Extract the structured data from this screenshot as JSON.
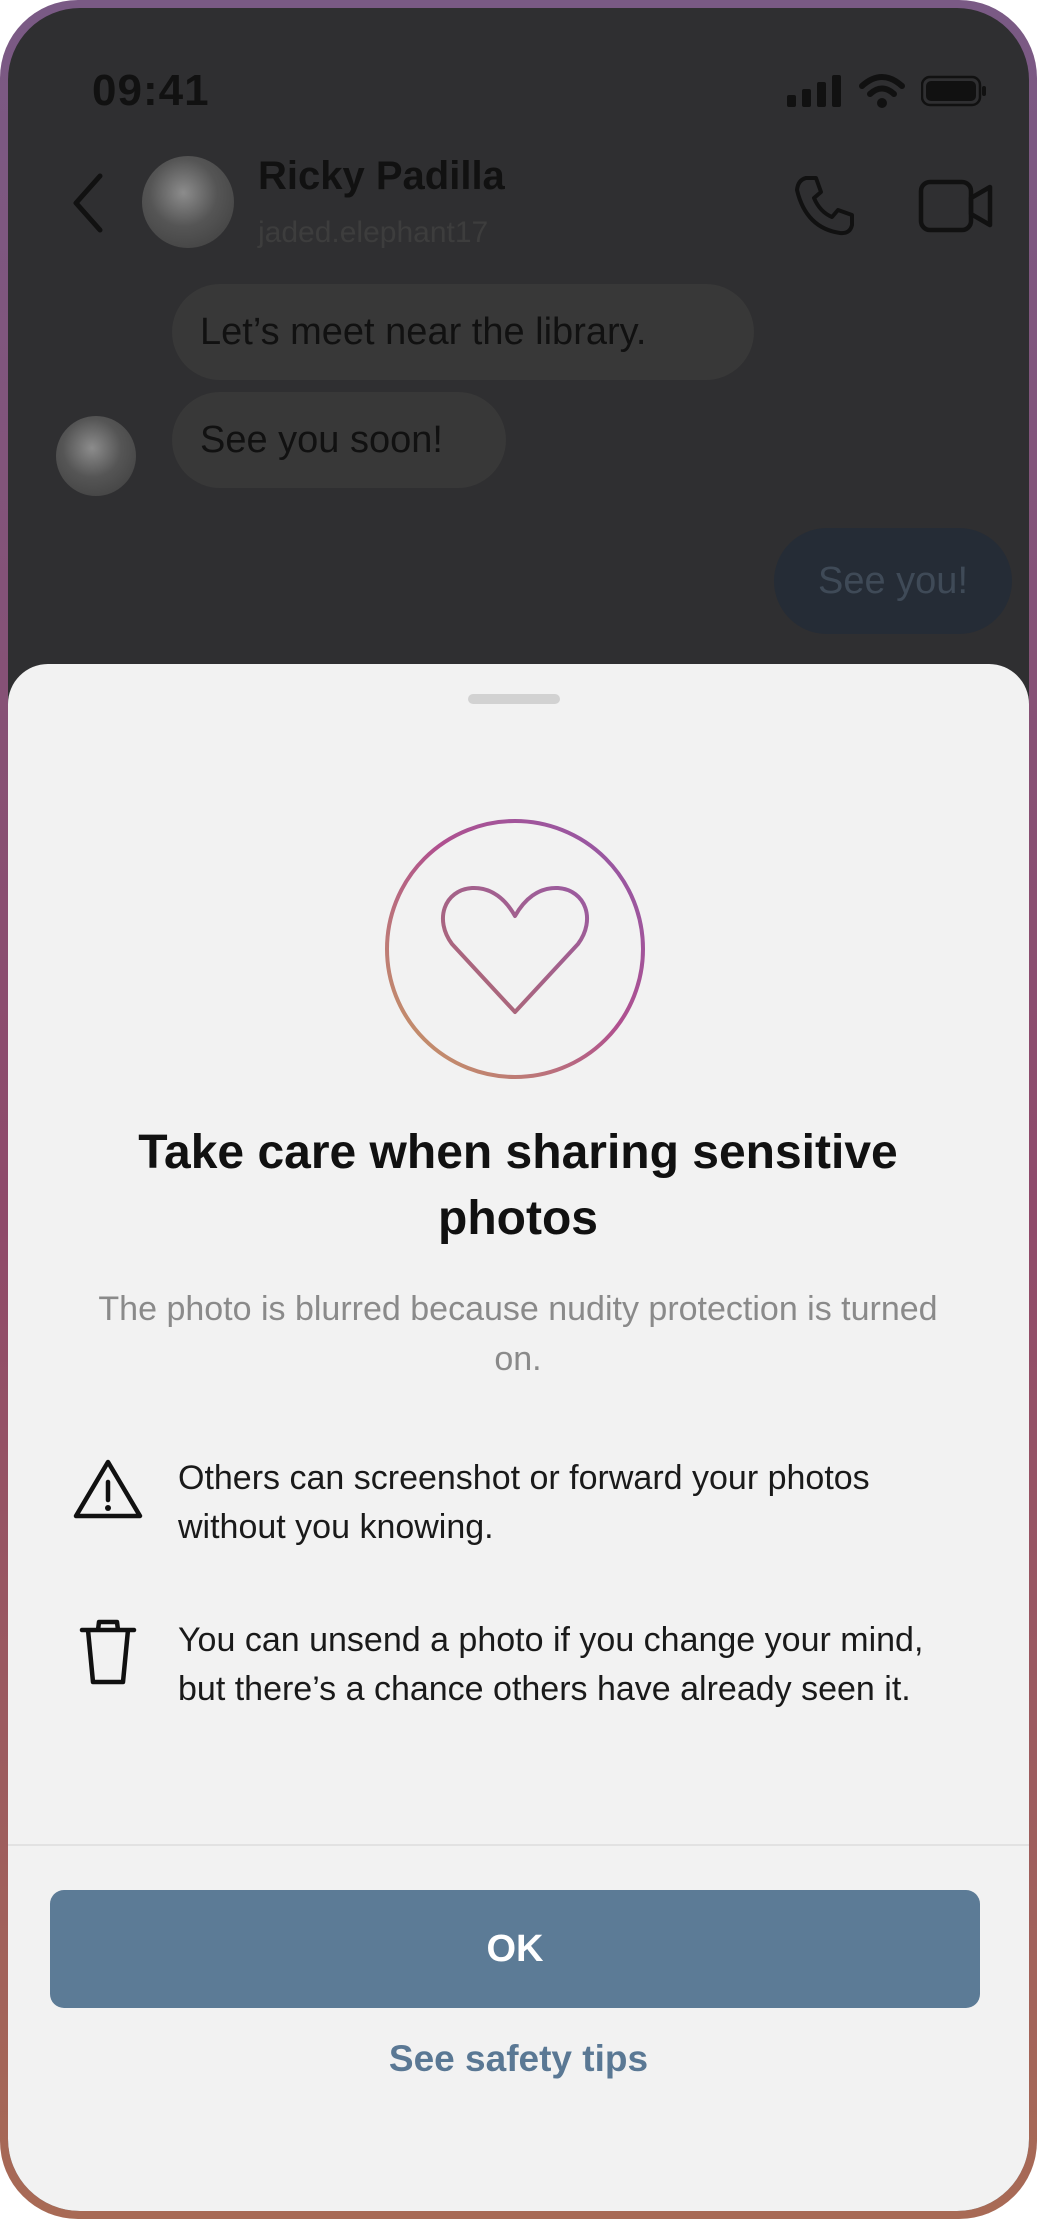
{
  "status_bar": {
    "time": "09:41",
    "icons": [
      "signal-icon",
      "wifi-icon",
      "battery-icon"
    ]
  },
  "header": {
    "contact_name": "Ricky Padilla",
    "username": "jaded.elephant17",
    "icons": [
      "back-chevron-icon",
      "phone-icon",
      "video-camera-icon"
    ]
  },
  "messages": [
    {
      "direction": "incoming",
      "text": "Let’s meet near the library."
    },
    {
      "direction": "incoming",
      "text": "See you soon!"
    },
    {
      "direction": "outgoing",
      "text": "See you!"
    }
  ],
  "sheet": {
    "title": "Take care when sharing sensitive photos",
    "subtitle": "The photo is blurred because nudity protection is turned on.",
    "tips": [
      {
        "icon": "warning-triangle-icon",
        "text": "Others can screenshot or forward your photos without you knowing."
      },
      {
        "icon": "trash-icon",
        "text": "You can unsend a photo if you change your mind, but there’s a chance others have already seen it."
      }
    ],
    "ok_label": "OK",
    "safety_tips_label": "See safety tips"
  },
  "colors": {
    "primary_button": "#5c7b96",
    "link": "#5a7894",
    "overlay_background": "#2f2f31",
    "sheet_background": "#f2f2f2"
  }
}
